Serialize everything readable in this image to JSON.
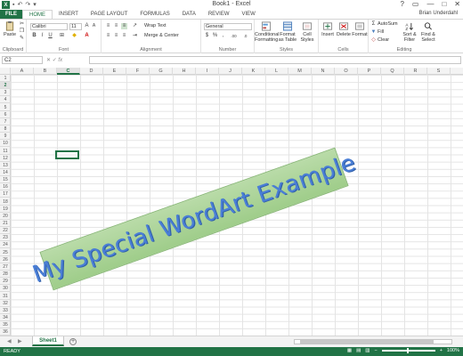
{
  "window": {
    "title": "Book1 - Excel",
    "user": "Brian Underdahl",
    "controls": [
      "?",
      "▭",
      "—",
      "□",
      "✕"
    ]
  },
  "tabs": [
    "FILE",
    "HOME",
    "INSERT",
    "PAGE LAYOUT",
    "FORMULAS",
    "DATA",
    "REVIEW",
    "VIEW"
  ],
  "ribbon": {
    "clipboard": {
      "label": "Clipboard",
      "paste": "Paste"
    },
    "font": {
      "label": "Font",
      "name": "Calibri",
      "size": "11",
      "bold": "B",
      "italic": "I",
      "underline": "U"
    },
    "alignment": {
      "label": "Alignment",
      "wrap": "Wrap Text",
      "merge": "Merge & Center"
    },
    "number": {
      "label": "Number",
      "format": "General",
      "currency": "$",
      "percent": "%",
      "comma": ",",
      "dec_more": ".00",
      "dec_less": ".0"
    },
    "styles": {
      "label": "Styles",
      "cond": "Conditional Formatting",
      "table": "Format as Table",
      "cell": "Cell Styles"
    },
    "cells": {
      "label": "Cells",
      "insert": "Insert",
      "delete": "Delete",
      "format": "Format"
    },
    "editing": {
      "label": "Editing",
      "autosum": "AutoSum",
      "fill": "Fill",
      "clear": "Clear",
      "sort": "Sort & Filter",
      "find": "Find & Select"
    }
  },
  "formula_bar": {
    "name_box": "C2",
    "fx": "fx",
    "value": ""
  },
  "columns": [
    "A",
    "B",
    "C",
    "D",
    "E",
    "F",
    "G",
    "H",
    "I",
    "J",
    "K",
    "L",
    "M",
    "N",
    "O",
    "P",
    "Q",
    "R",
    "S"
  ],
  "selected_column": "C",
  "rows": [
    1,
    2,
    3,
    4,
    5,
    6,
    7,
    8,
    9,
    10,
    11,
    12,
    13,
    14,
    15,
    16,
    17,
    18,
    19,
    20,
    21,
    22,
    23,
    24,
    25,
    26,
    27,
    28,
    29,
    30,
    31,
    32,
    33,
    34,
    35,
    36
  ],
  "selected_row": 2,
  "wordart": {
    "text": "My Special WordArt Example"
  },
  "sheets": {
    "active": "Sheet1",
    "add": "+"
  },
  "status": {
    "ready": "READY",
    "zoom": "100%"
  },
  "colors": {
    "excel_green": "#217346",
    "wordart_fill": "#a8d393",
    "wordart_text": "#4a7ed6"
  }
}
